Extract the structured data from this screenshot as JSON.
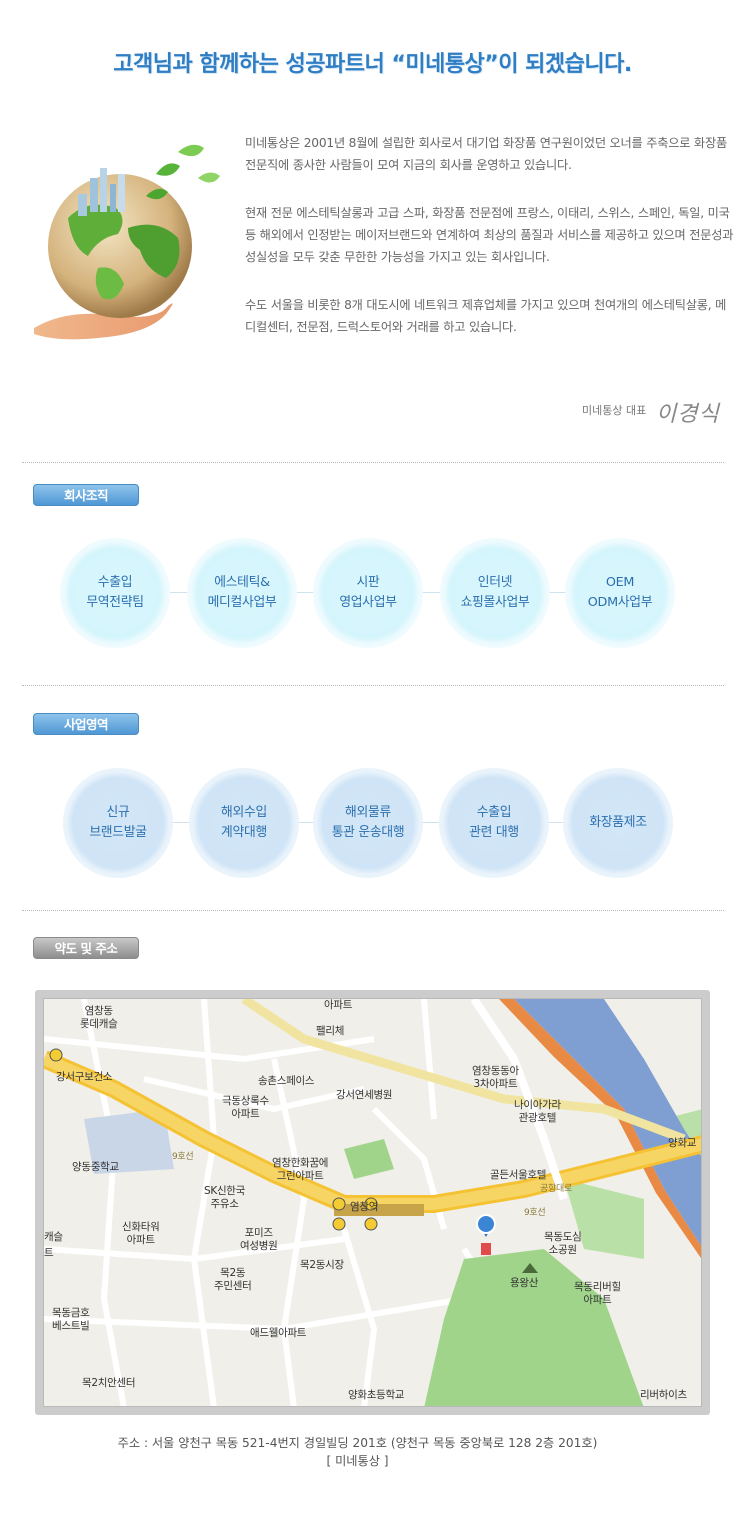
{
  "header": {
    "headline": "고객님과 함께하는 성공파트너 “미네통상”이 되겠습니다."
  },
  "intro": {
    "paragraphs": [
      "미네통상은 2001년 8월에 설립한 회사로서 대기업 화장품 연구원이었던 오너를 주축으로 화장품 전문직에 종사한 사람들이 모여 지금의 회사를 운영하고 있습니다.",
      "현재 전문 에스테틱살롱과 고급 스파, 화장품 전문점에 프랑스, 이태리, 스위스, 스페인, 독일, 미국등 해외에서 인정받는 메이저브랜드와 연계하여 최상의 품질과 서비스를 제공하고 있으며 전문성과 성실성을 모두 갖춘 무한한 가능성을 가지고 있는 회사입니다.",
      "수도 서울을 비롯한 8개 대도시에 네트워크 제휴업체를 가지고 있으며 천여개의 에스테틱살롱, 메디컬센터, 전문점, 드럭스토어와 거래를 하고 있습니다."
    ],
    "signature_title": "미네통상 대표",
    "signature_name": "이경식"
  },
  "organization": {
    "label": "회사조직",
    "items": [
      "수출입\n무역전략팀",
      "에스테틱&\n메디컬사업부",
      "시판\n영업사업부",
      "인터넷\n쇼핑몰사업부",
      "OEM\nODM사업부"
    ]
  },
  "business": {
    "label": "사업영역",
    "items": [
      "신규\n브랜드발굴",
      "해외수입\n계약대행",
      "해외물류\n통관 운송대행",
      "수출입\n관련 대행",
      "화장품제조"
    ]
  },
  "location": {
    "label": "약도 및 주소",
    "map_labels": {
      "l1": "염창동\n롯데캐슬",
      "l2": "아파트",
      "l3": "팰리체",
      "l4": "강서구보건소",
      "l5": "송촌스페이스",
      "l6": "극동상록수\n아파트",
      "l7": "강서연세병원",
      "l8": "염창동동아\n3차아파트",
      "l9": "나이아가라\n관광호텔",
      "l10": "양화교",
      "l11": "양동중학교",
      "l12": "9호선",
      "l13": "SK신한국\n주유소",
      "l14": "염창한화꿈에\n그린아파트",
      "l15": "골든서울호텔",
      "l16": "공항대로",
      "l17": "9호선",
      "l18": "염창역",
      "l19": "신화타워\n아파트",
      "l20": "포미즈\n여성병원",
      "l21": "목동도심\n소공원",
      "l22": "목2동\n주민센터",
      "l23": "목2동시장",
      "l24": "목동리버힐\n아파트",
      "l25": "목동금호\n베스트빌",
      "l26": "애드웰아파트",
      "l27": "용왕산",
      "l28": "목2치안센터",
      "l29": "양화초등학교",
      "l30": "리버하이츠",
      "l31": "캐슬",
      "l32": "트"
    },
    "address_line": "주소 : 서울 양천구 목동 521-4번지 경일빌딩 201호 (양천구 목동 중앙북로 128  2층 201호)",
    "company": "[ 미네통상 ]"
  }
}
